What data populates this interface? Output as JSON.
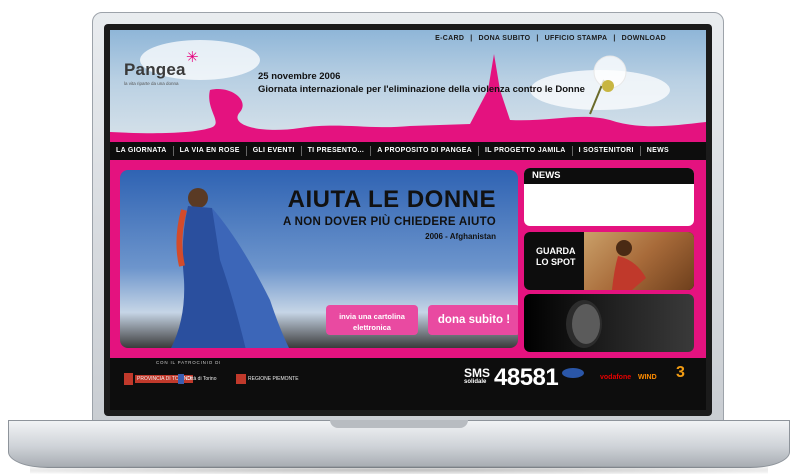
{
  "top_links": [
    "E-CARD",
    "DONA SUBITO",
    "UFFICIO STAMPA",
    "DOWNLOAD"
  ],
  "logo": {
    "name": "Pangea",
    "tagline": "la vita riparte da una donna"
  },
  "headline": {
    "date": "25 novembre 2006",
    "text": "Giornata internazionale per l'eliminazione della violenza contro le Donne"
  },
  "nav": [
    "LA GIORNATA",
    "LA VIA EN ROSE",
    "GLI EVENTI",
    "TI PRESENTO...",
    "A PROPOSITO DI PANGEA",
    "IL PROGETTO JAMILA",
    "I SOSTENITORI",
    "NEWS"
  ],
  "hero": {
    "title": "AIUTA LE DONNE",
    "subtitle": "A NON DOVER PIÙ CHIEDERE AIUTO",
    "year_place": "2006 - Afghanistan",
    "card_button": "invia una cartolina elettronica",
    "donate_button": "dona subito !"
  },
  "news": {
    "title": "NEWS"
  },
  "spot": {
    "label_line1": "GUARDA",
    "label_line2": "LO SPOT"
  },
  "footer": {
    "patrocinio": "CON IL PATROCINIO DI",
    "sponsors": [
      "PROVINCIA DI TORINO",
      "Città di Torino",
      "REGIONE PIEMONTE"
    ],
    "sms_word": "SMS",
    "sms_solidale": "solidale",
    "sms_number": "48581",
    "operators": [
      "vodafone",
      "WIND",
      "3"
    ]
  },
  "colors": {
    "brand_pink": "#e4127f",
    "nav_black": "#0d0d0d"
  }
}
